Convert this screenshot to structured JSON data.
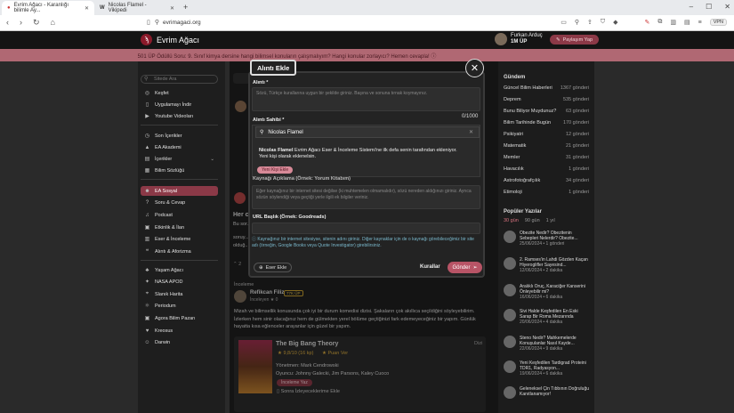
{
  "browser": {
    "tabs": [
      {
        "title": "Evrim Ağacı - Karanlığı bilimle Ay..."
      },
      {
        "title": "Nicolas Flamel - Vikipedi"
      }
    ],
    "url": "evrimagaci.org",
    "vpn": "VPN"
  },
  "site": {
    "name": "Evrim Ağacı",
    "user_name": "Furkan Arduç",
    "user_up": "1M ÜP",
    "share_label": "Paylaşım Yap",
    "banner": "501 ÜP Ödüllü Soru: 9. Sınıf kimya dersine hangi bilimsel konuların çalışmalıyım? Hangi konular zorlayıcı? Hemen cevapla! ⓘ"
  },
  "sidebar": {
    "search_placeholder": "Sitede Ara",
    "items": [
      {
        "label": "Keşfet",
        "icon": "compass"
      },
      {
        "label": "Uygulamayı İndir",
        "icon": "phone"
      },
      {
        "label": "Youtube Videoları",
        "icon": "play"
      },
      {
        "label": "Son İçerikler",
        "icon": "clock"
      },
      {
        "label": "EA Akademi",
        "icon": "graduation"
      },
      {
        "label": "İçerikler",
        "icon": "book"
      },
      {
        "label": "Bilim Sözlüğü",
        "icon": "dictionary"
      },
      {
        "label": "EA Sosyal",
        "icon": "people"
      },
      {
        "label": "Soru & Cevap",
        "icon": "question"
      },
      {
        "label": "Podcast",
        "icon": "mic"
      },
      {
        "label": "Etkinlik & İlan",
        "icon": "calendar"
      },
      {
        "label": "Eser & İnceleme",
        "icon": "book-open"
      },
      {
        "label": "Alıntı & Aforizma",
        "icon": "quote"
      },
      {
        "label": "Yaşam Ağacı",
        "icon": "tree"
      },
      {
        "label": "NASA APOD",
        "icon": "telescope"
      },
      {
        "label": "Slanık Harita",
        "icon": "map"
      },
      {
        "label": "Periodum",
        "icon": "atom"
      },
      {
        "label": "Agora Bilim Pazarı",
        "icon": "shop"
      },
      {
        "label": "Kreosus",
        "icon": "heart"
      },
      {
        "label": "Darwin",
        "icon": "bot"
      }
    ]
  },
  "gundem": {
    "title": "Gündem",
    "items": [
      {
        "label": "Güncel Bilim Haberleri",
        "count": "1367 gönderi"
      },
      {
        "label": "Deprem",
        "count": "535 gönderi"
      },
      {
        "label": "Bunu Biliyor Muydunuz?",
        "count": "63 gönderi"
      },
      {
        "label": "Bilim Tarihinde Bugün",
        "count": "170 gönderi"
      },
      {
        "label": "Psikiyatri",
        "count": "12 gönderi"
      },
      {
        "label": "Matematik",
        "count": "21 gönderi"
      },
      {
        "label": "Memler",
        "count": "31 gönderi"
      },
      {
        "label": "Havacılık",
        "count": "1 gönderi"
      },
      {
        "label": "Astrofotoğrafçılık",
        "count": "34 gönderi"
      },
      {
        "label": "Etimoloji",
        "count": "1 gönderi"
      }
    ]
  },
  "popular": {
    "title": "Popüler Yazılar",
    "tabs": [
      "30 gün",
      "90 gün",
      "1 yıl"
    ],
    "items": [
      {
        "title": "Obezite Nedir? Obezitenin Sebepleri Nelerdir? Obezite...",
        "meta": "25/06/2024 • 1 gönderi"
      },
      {
        "title": "2. Ramses'in Lahdi Gözden Kaçan Hiyeroglifler Sayesind...",
        "meta": "12/06/2024 • 2 dakika"
      },
      {
        "title": "Aralıklı Oruç, Karaciğer Kanserini Önleyebilir mi?",
        "meta": "16/06/2024 • 6 dakika"
      },
      {
        "title": "Sivi Halde Keşfedilen En Eski Sarap Bir Roma Mezarında",
        "meta": "20/06/2024 • 4 dakika"
      },
      {
        "title": "Steno Nedir? Mahkemelerde Konuşulanlar Nasıl Kayde...",
        "meta": "22/06/2024 • 9 dakika"
      },
      {
        "title": "Yeni Keşfedilen Tardigrad Proteini TDR1, Radyasyon...",
        "meta": "19/06/2024 • 6 dakika"
      },
      {
        "title": "Geleneksel Çin Tıbbının Doğruluğu Kanıtlanamıyor!",
        "meta": ""
      }
    ]
  },
  "background": {
    "post_header": "Her c...",
    "post_line": "Bu sor...",
    "line3": "soruy...",
    "line4": "olduğ...",
    "reply_count": "2",
    "section": "İnceleme",
    "reviewer": "Refikcan Filiz",
    "reviewer_badge": "77K ÜP",
    "review_sub": "İnceleyen ★ 0",
    "review_text": "Mizah ve bilimsellik konusunda çok iyi bir durum komedisi dizisi. Şakaların çok akıllıca seçildiğini söyleyebilirim. İzlerken hem sinir olacağınız hem de gülmekten yerel bölüme geçtiğinizi fark edemeyeceğiniz bir yapım. Günlük hayatta kısa eğlenceler arayanlar için güzel bir yapım.",
    "work_title": "The Big Bang Theory",
    "work_type": "Dizi",
    "rating": "★ 9,8/10 (16 kp)",
    "rate_action": "★ Puan Ver",
    "director": "Yönetmen: Mark Cendrowski",
    "cast": "Oyuncu: Johnny Galecki, Jim Parsons, Kaley Cuoco",
    "status_badge": "İnceleme Yaz",
    "later": "Sonra İzleyeceklerime Ekle"
  },
  "modal": {
    "title": "Alıntı Ekle",
    "quote_label": "Alıntı *",
    "quote_placeholder": "Sözü, Türkçe kurallarına uygun bir şekilde giriniz. Başına ve sonuna tırnak koymayınız.",
    "counter": "0/1000",
    "owner_label": "Alıntı Sahibi *",
    "owner_value": "Nicolas Flamel",
    "dd_msg_bold": "Nicolas Flamel",
    "dd_msg": " Evrim Ağacı Eser & İnceleme Sistemi'ne ilk defa senin tarafından ekleniyor. Yeni kişi olarak eklenelsin.",
    "dd_add": "Yeni Kişi Ekle",
    "source_label": "Kaynağı Açıklama (Örnek: Yorum Kitabım)",
    "source_placeholder": "Eğer kaynağınız bir internet sitesi değilse (ki muhtemelen olmamalıdır), sözü nereden aldığınızı giriniz. Ayrıca sözün söylendiği veya geçtiği yerle ilgili ek bilgiler veriniz.",
    "url_label": "URL Başlık (Örnek: Goodreads)",
    "hint": "Kaynağınız bir internet sitesiyse, sitenin adını giriniz. Diğer kaynaklar için de o kaynağı görebileceğimiz bir site adı (örneğin, Google Books veya Quote Investigator) girebilirsiniz.",
    "eser_label": "Eser Ekle",
    "rules_label": "Kurallar",
    "submit_label": "Gönder"
  }
}
